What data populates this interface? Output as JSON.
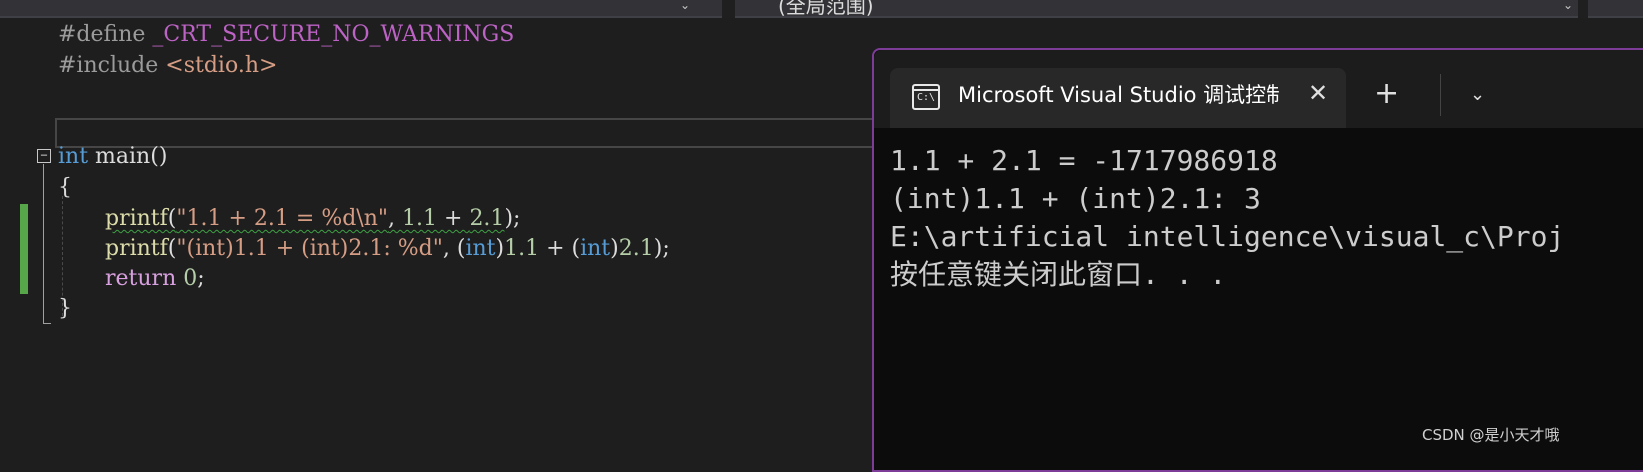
{
  "toolbar": {
    "scope_text": "(全局范围)"
  },
  "editor": {
    "lines": [
      {
        "directive": "#define",
        "name": "_CRT_SECURE_NO_WARNINGS"
      },
      {
        "directive": "#include",
        "header": "<stdio.h>"
      },
      {
        "kw": "int",
        "rest": "main()"
      },
      {
        "text": "{"
      },
      {
        "fn": "printf",
        "open": "(",
        "str": "\"1.1 + 2.1 = %d\\n\"",
        "sep": ", ",
        "n1": "1.1",
        "op": " + ",
        "n2": "2.1",
        "close": ");"
      },
      {
        "fn": "printf",
        "open": "(",
        "str": "\"(int)1.1 + (int)2.1: %d\"",
        "sep": ", ",
        "cast1_open": "(",
        "kw1": "int",
        "cast1_close": ")",
        "n1": "1.1",
        "op": " + ",
        "cast2_open": "(",
        "kw2": "int",
        "cast2_close": ")",
        "n2": "2.1",
        "close": ");"
      },
      {
        "kw": "return",
        "num": "0",
        "end": ";"
      },
      {
        "text": "}"
      }
    ],
    "collapse_glyph": "−"
  },
  "terminal": {
    "tab_title": "Microsoft Visual Studio 调试控制台",
    "icon_text": "C:\\",
    "close_glyph": "✕",
    "new_tab_glyph": "+",
    "dropdown_glyph": "⌄",
    "output": [
      "1.1 + 2.1 = -1717986918",
      "(int)1.1 + (int)2.1: 3",
      "E:\\artificial intelligence\\visual_c\\Proj",
      "按任意键关闭此窗口. . ."
    ]
  },
  "watermark": "CSDN @是小天才哦",
  "colors": {
    "editor_bg": "#1e1e1e",
    "terminal_bg": "#0c0c0c",
    "terminal_border": "#7d3c98",
    "change_bar": "#57a64a",
    "keyword": "#569cd6",
    "string": "#d69d85"
  }
}
